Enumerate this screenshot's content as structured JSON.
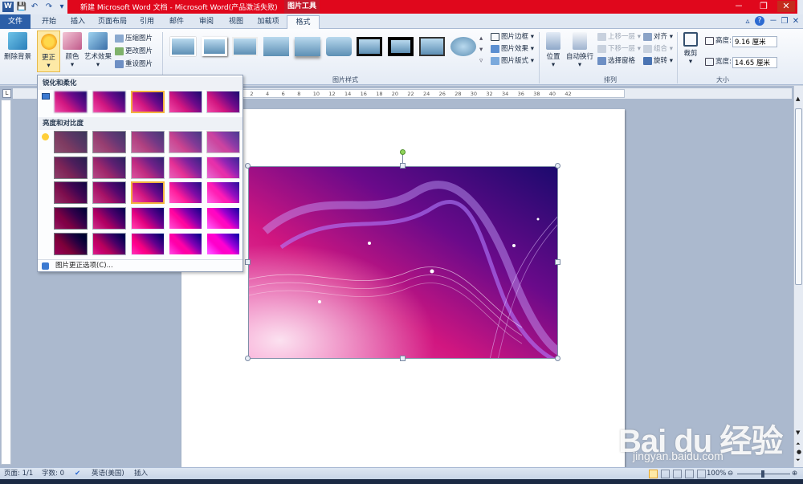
{
  "window": {
    "title": "新建 Microsoft Word 文档 - Microsoft Word(产品激活失败)",
    "tools_tab_head": "图片工具",
    "controls": {
      "minimize": "－",
      "restore": "❐",
      "close": "✕"
    }
  },
  "quick_access": {
    "save": "💾",
    "undo": "↶",
    "redo": "↷",
    "customize": "▾"
  },
  "tabs": [
    {
      "label": "文件",
      "id": "file"
    },
    {
      "label": "开始",
      "id": "home"
    },
    {
      "label": "插入",
      "id": "insert"
    },
    {
      "label": "页面布局",
      "id": "layout"
    },
    {
      "label": "引用",
      "id": "references"
    },
    {
      "label": "邮件",
      "id": "mailings"
    },
    {
      "label": "审阅",
      "id": "review"
    },
    {
      "label": "视图",
      "id": "view"
    },
    {
      "label": "加载项",
      "id": "addins"
    },
    {
      "label": "格式",
      "id": "format"
    }
  ],
  "ribbon": {
    "remove_background": "删除背景",
    "corrections": "更正",
    "color": "颜色",
    "artistic_effects": "艺术效果",
    "compress": "压缩图片",
    "change_picture": "更改图片",
    "reset_picture": "重设图片",
    "picture_styles_group": "图片样式",
    "picture_border": "图片边框",
    "picture_effects": "图片效果",
    "picture_layout": "图片版式",
    "position": "位置",
    "wrap_text": "自动换行",
    "bring_forward": "上移一层",
    "send_backward": "下移一层",
    "selection_pane": "选择窗格",
    "align": "对齐",
    "group": "组合",
    "rotate": "旋转",
    "arrange_group": "排列",
    "crop": "裁剪",
    "height_label": "高度:",
    "height_value": "9.16 厘米",
    "width_label": "宽度:",
    "width_value": "14.65 厘米",
    "size_group": "大小"
  },
  "corrections_menu": {
    "sharpen_header": "锐化和柔化",
    "brightness_header": "亮度和对比度",
    "options": "图片更正选项(C)..."
  },
  "ruler_ticks": [
    "8",
    "6",
    "4",
    "2",
    "2",
    "4",
    "6",
    "8",
    "10",
    "12",
    "14",
    "16",
    "18",
    "20",
    "22",
    "24",
    "26",
    "28",
    "30",
    "32",
    "34",
    "36",
    "38",
    "40",
    "42"
  ],
  "status": {
    "page": "页面: 1/1",
    "words": "字数: 0",
    "language": "英语(美国)",
    "insert_mode": "插入",
    "zoom": "100%"
  },
  "watermark": {
    "logo": "Bai du 经验",
    "url": "jingyan.baidu.com"
  },
  "colors": {
    "title_red": "#e0071c",
    "file_tab": "#2c5fa8",
    "accent_selection": "#f2b33f"
  }
}
